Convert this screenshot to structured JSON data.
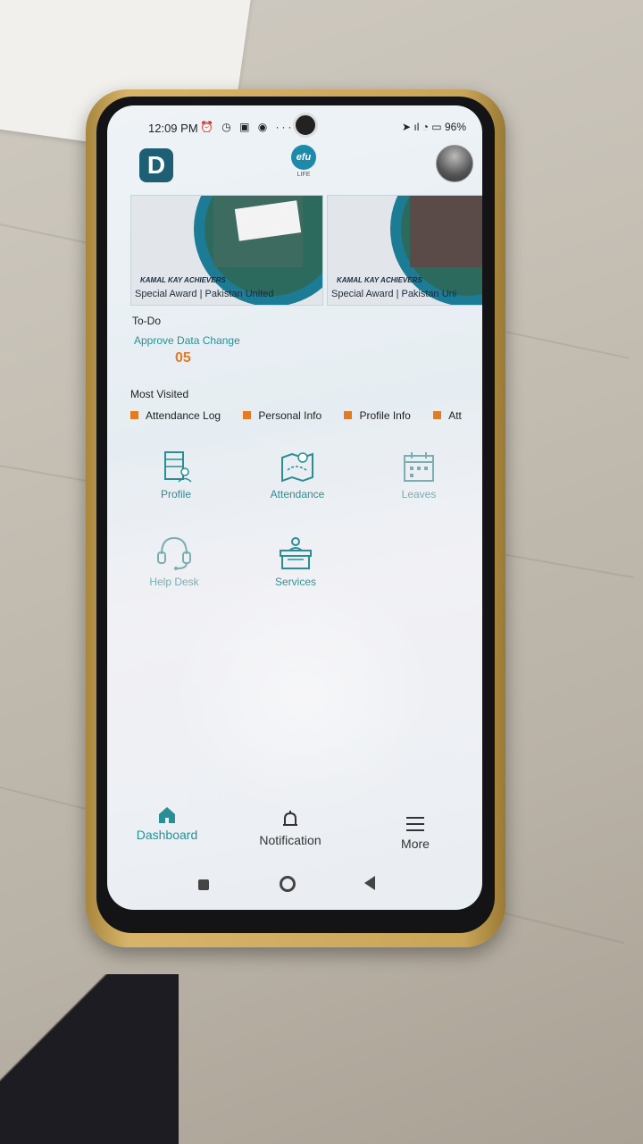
{
  "status": {
    "time": "12:09 PM",
    "left_icons": "⏰ ◷ ▣ ◉ ···",
    "right": "➤ ıl ◔ ▭ 96%"
  },
  "header": {
    "logo_letter": "D",
    "brand": "efu",
    "brand_sub": "LIFE"
  },
  "banners": [
    {
      "tag": "KAMAL KAY ACHIEVERS",
      "caption": "Special Award | Pakistan United"
    },
    {
      "tag": "KAMAL KAY ACHIEVERS",
      "caption": "Special Award | Pakistan Uni"
    }
  ],
  "todo": {
    "heading": "To-Do",
    "item_label": "Approve Data Change",
    "item_count": "05"
  },
  "most_visited": {
    "heading": "Most Visited",
    "items": [
      "Attendance Log",
      "Personal Info",
      "Profile Info",
      "Att"
    ]
  },
  "tiles": [
    {
      "label": "Profile",
      "icon": "profile-icon"
    },
    {
      "label": "Attendance",
      "icon": "attendance-icon"
    },
    {
      "label": "Leaves",
      "icon": "calendar-icon"
    },
    {
      "label": "Help Desk",
      "icon": "headset-icon"
    },
    {
      "label": "Services",
      "icon": "reception-icon"
    }
  ],
  "bottom_nav": {
    "dashboard": "Dashboard",
    "notification": "Notification",
    "more": "More"
  },
  "colors": {
    "accent": "#2a8f95",
    "orange": "#e07b28",
    "brand_dark": "#1f5f73"
  }
}
